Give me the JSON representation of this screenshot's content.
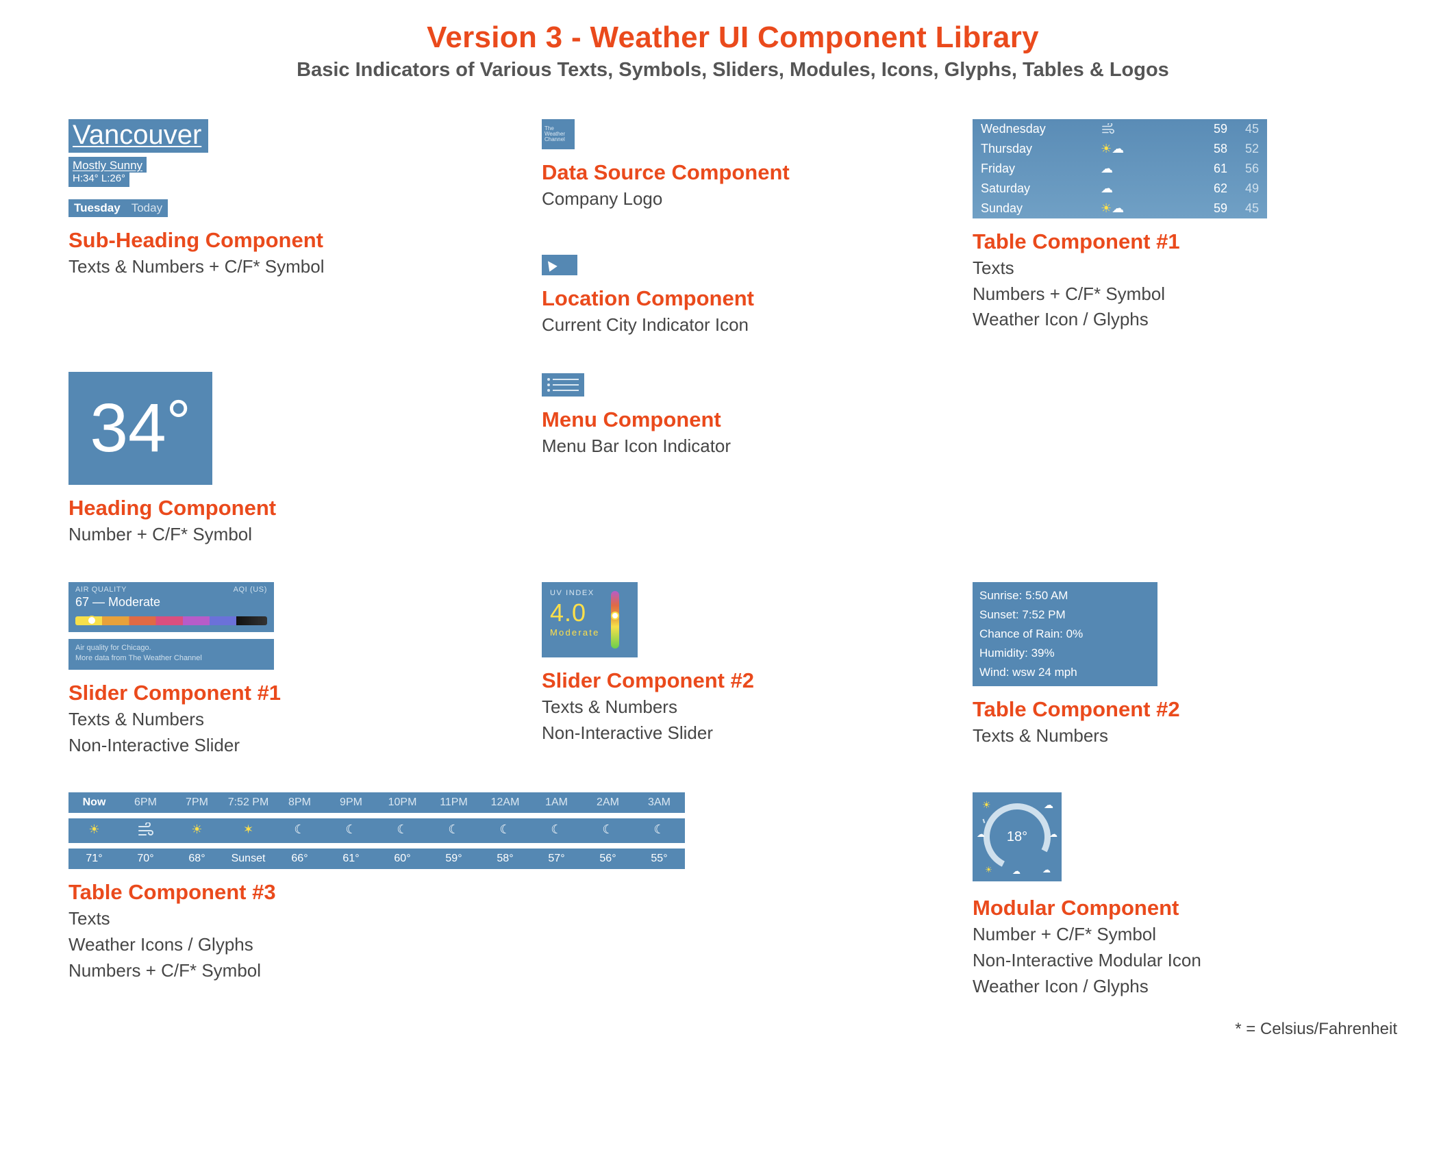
{
  "title": "Version 3 - Weather UI Component Library",
  "subtitle": "Basic Indicators of Various Texts, Symbols, Sliders, Modules, Icons, Glyphs, Tables & Logos",
  "footnote": "* = Celsius/Fahrenheit",
  "subheading": {
    "title": "Sub-Heading Component",
    "desc": "Texts & Numbers + C/F* Symbol",
    "city": "Vancouver",
    "condition": "Mostly Sunny",
    "hi_lo": "H:34° L:26°",
    "day_bold": "Tuesday",
    "day_dim": "Today"
  },
  "heading": {
    "title": "Heading Component",
    "desc": "Number + C/F* Symbol",
    "temp": "34",
    "deg": "°"
  },
  "aqi": {
    "title": "Slider Component #1",
    "desc1": "Texts & Numbers",
    "desc2": "Non-Interactive Slider",
    "label_left": "AIR QUALITY",
    "label_right": "AQI (US)",
    "value": "67 — Moderate",
    "note1": "Air quality for Chicago.",
    "note2": "More data from The Weather Channel"
  },
  "datasource": {
    "title": "Data Source Component",
    "desc": "Company Logo",
    "logo_l1": "The",
    "logo_l2": "Weather",
    "logo_l3": "Channel"
  },
  "location": {
    "title": "Location Component",
    "desc": "Current City Indicator Icon"
  },
  "menu": {
    "title": "Menu Component",
    "desc": "Menu Bar Icon Indicator"
  },
  "uv": {
    "title": "Slider Component #2",
    "desc1": "Texts & Numbers",
    "desc2": "Non-Interactive Slider",
    "label": "UV INDEX",
    "value": "4.0",
    "rating": "Moderate"
  },
  "tbl1": {
    "title": "Table Component #1",
    "desc1": "Texts",
    "desc2": "Numbers + C/F* Symbol",
    "desc3": "Weather Icon / Glyphs",
    "rows": [
      {
        "day": "Wednesday",
        "icon": "wind",
        "hi": "59",
        "lo": "45"
      },
      {
        "day": "Thursday",
        "icon": "partly-cloudy",
        "hi": "58",
        "lo": "52"
      },
      {
        "day": "Friday",
        "icon": "rain",
        "hi": "61",
        "lo": "56"
      },
      {
        "day": "Saturday",
        "icon": "rain",
        "hi": "62",
        "lo": "49"
      },
      {
        "day": "Sunday",
        "icon": "partly-cloudy",
        "hi": "59",
        "lo": "45"
      }
    ]
  },
  "tbl2": {
    "title": "Table Component #2",
    "desc": "Texts & Numbers",
    "lines": [
      "Sunrise: 5:50 AM",
      "Sunset: 7:52 PM",
      "Chance of Rain: 0%",
      "Humidity: 39%",
      "Wind: wsw 24 mph"
    ]
  },
  "modular": {
    "title": "Modular Component",
    "desc1": "Number + C/F*  Symbol",
    "desc2": "Non-Interactive Modular Icon",
    "desc3": "Weather Icon / Glyphs",
    "center": "18°"
  },
  "tbl3": {
    "title": "Table Component #3",
    "desc1": "Texts",
    "desc2": "Weather Icons / Glyphs",
    "desc3": "Numbers + C/F* Symbol",
    "times": [
      "Now",
      "6PM",
      "7PM",
      "7:52 PM",
      "8PM",
      "9PM",
      "10PM",
      "11PM",
      "12AM",
      "1AM",
      "2AM",
      "3AM"
    ],
    "icons": [
      "sun",
      "wind",
      "sun",
      "sunset",
      "moon",
      "moon",
      "moon",
      "moon",
      "moon",
      "moon",
      "moon",
      "moon"
    ],
    "temps": [
      "71°",
      "70°",
      "68°",
      "Sunset",
      "66°",
      "61°",
      "60°",
      "59°",
      "58°",
      "57°",
      "56°",
      "55°"
    ]
  }
}
